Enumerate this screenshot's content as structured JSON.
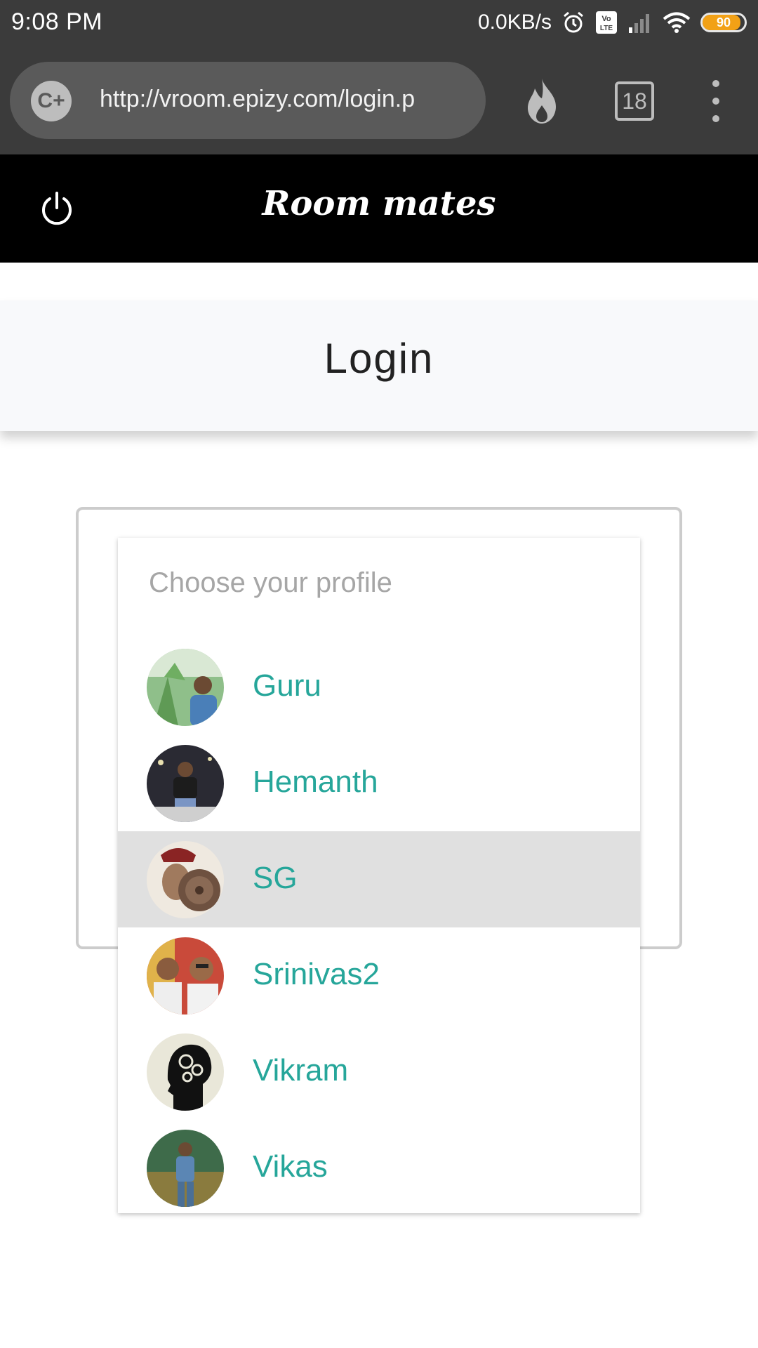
{
  "status_bar": {
    "time": "9:08 PM",
    "speed": "0.0KB/s",
    "battery_level": "90",
    "battery_fraction": 0.9,
    "icons": [
      "alarm-icon",
      "volte-icon",
      "signal-icon",
      "wifi-icon",
      "battery-icon"
    ]
  },
  "browser": {
    "site_badge": "C+",
    "url": "http://vroom.epizy.com/login.p",
    "tab_count": "18",
    "icons": [
      "flame-icon",
      "tabs-icon",
      "more-vert-icon"
    ]
  },
  "app_header": {
    "title": "Room mates",
    "icon": "power-icon"
  },
  "page": {
    "title": "Login"
  },
  "profile_dropdown": {
    "header": "Choose your profile",
    "selected": "SG",
    "profiles": [
      {
        "name": "Guru"
      },
      {
        "name": "Hemanth"
      },
      {
        "name": "SG"
      },
      {
        "name": "Srinivas2"
      },
      {
        "name": "Vikram"
      },
      {
        "name": "Vikas"
      }
    ]
  },
  "colors": {
    "status_bg": "#3b3b3b",
    "header_bg": "#000000",
    "accent": "#26a69a",
    "selected_bg": "#e0e0e0",
    "battery": "#f2a116"
  }
}
